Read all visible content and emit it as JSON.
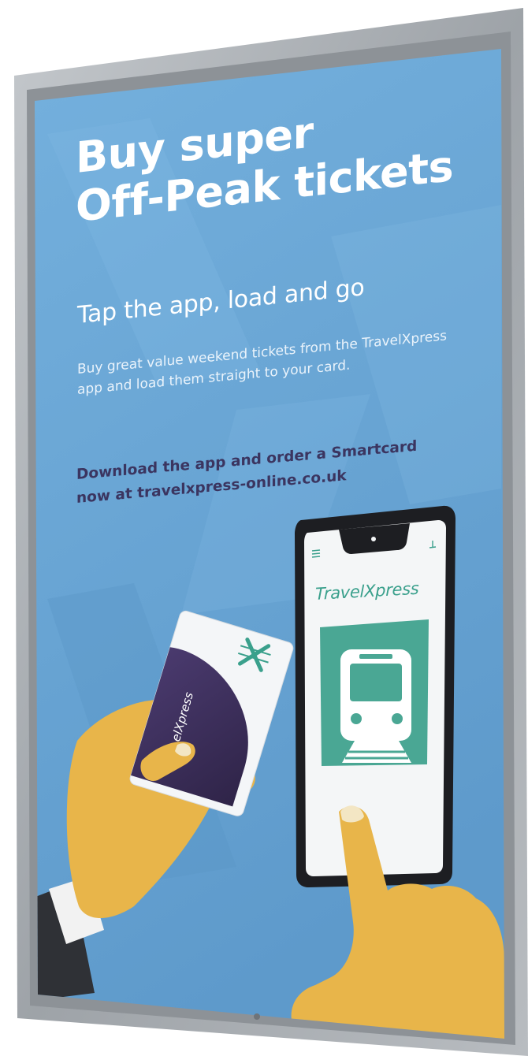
{
  "poster": {
    "headline_line1": "Buy super",
    "headline_line2": "Off-Peak tickets",
    "subheadline": "Tap the app, load and go",
    "body": "Buy great value weekend tickets from the TravelXpress app and load them straight to your card.",
    "cta_line1": "Download the app and order a Smartcard",
    "cta_line2": "now at travelxpress-online.co.uk"
  },
  "phone": {
    "app_name": "TravelXpress",
    "menu_icon": "hamburger-menu-icon",
    "app_icon": "train-icon"
  },
  "smartcard": {
    "brand_text": "elXpress",
    "logo_icon": "x-track-logo-icon"
  },
  "colors": {
    "poster_background": "#6aa6d6",
    "frame": "#a9aeb3",
    "headline_text": "#ffffff",
    "cta_text": "#3b3560",
    "brand_teal": "#3aa08c",
    "card_purple": "#3e2f5f",
    "skin": "#e8b54a"
  }
}
